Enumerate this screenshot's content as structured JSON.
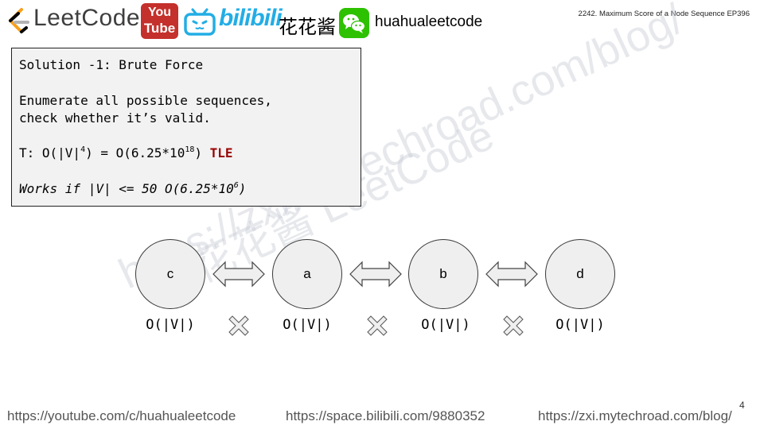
{
  "header": {
    "leetcode_text": "LeetCode",
    "youtube_top": "You",
    "youtube_bottom": "Tube",
    "bilibili_text": "bilibili",
    "chinese_name": "花花酱",
    "wechat_handle": "huahualeetcode",
    "episode_title": "2242. Maximum Score of a Node Sequence EP396"
  },
  "solution": {
    "title": "Solution -1: Brute Force",
    "desc_line1": "Enumerate all possible sequences,",
    "desc_line2": "check whether it’s valid.",
    "time_prefix": "T: O(|V|",
    "time_exp": "4",
    "time_mid": ") = O(6.25*10",
    "time_exp2": "18",
    "time_suffix": ") ",
    "tle": "TLE",
    "works_prefix": "Works if |V| <= 50 O(6.25*10",
    "works_exp": "6",
    "works_suffix": ")"
  },
  "watermark": {
    "line1": "https://zxi.mytechroad.com/blog/",
    "line2": "花花酱 LeetCode"
  },
  "diagram": {
    "nodes": [
      "c",
      "a",
      "b",
      "d"
    ],
    "costs": [
      "O(|V|)",
      "O(|V|)",
      "O(|V|)",
      "O(|V|)"
    ]
  },
  "footer": {
    "youtube_url": "https://youtube.com/c/huahualeetcode",
    "bilibili_url": "https://space.bilibili.com/9880352",
    "blog_url": "https://zxi.mytechroad.com/blog/",
    "page_number": "4"
  },
  "colors": {
    "tle": "#990000",
    "youtube": "#c4302b",
    "bilibili": "#23ade5",
    "wechat": "#2dc100"
  }
}
